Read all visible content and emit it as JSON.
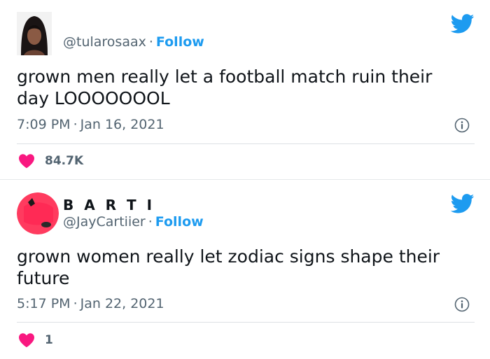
{
  "colors": {
    "accent": "#1d9bf0",
    "heart": "#f91880",
    "secondary_text": "#536471",
    "primary_text": "#0f1419"
  },
  "tweets": [
    {
      "display_name": "",
      "handle": "@tularosaax",
      "separator": "·",
      "follow_label": "Follow",
      "text": "grown men really let a football match ruin their day LOOOOOOOL",
      "time": "7:09 PM",
      "date": "Jan 16, 2021",
      "like_count": "84.7K",
      "icons": [
        "avatar",
        "twitter-bird-icon",
        "info-icon",
        "heart-icon"
      ]
    },
    {
      "display_name": "B A R T I",
      "handle": "@JayCartiier",
      "separator": "·",
      "follow_label": "Follow",
      "text": "grown women really let zodiac signs shape their future",
      "time": "5:17 PM",
      "date": "Jan 22, 2021",
      "like_count": "1",
      "icons": [
        "avatar",
        "twitter-bird-icon",
        "info-icon",
        "heart-icon"
      ]
    }
  ]
}
